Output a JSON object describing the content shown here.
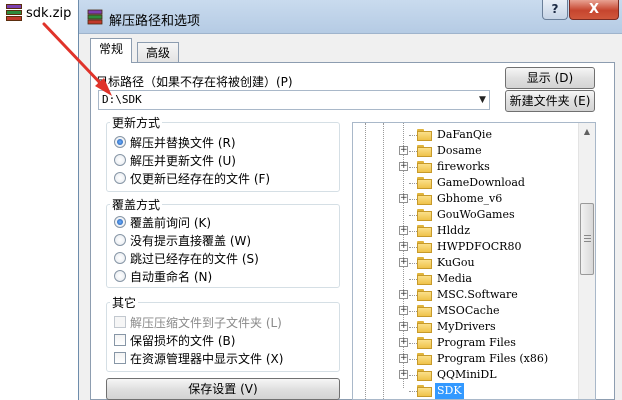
{
  "desktop": {
    "file_name": "sdk.zip"
  },
  "dialog": {
    "title": "解压路径和选项",
    "help_label": "?",
    "close_label": "X",
    "tabs": [
      {
        "label": "常规"
      },
      {
        "label": "高级"
      }
    ],
    "path_label": "目标路径（如果不存在将被创建）(P)",
    "path_value": "D:\\SDK",
    "show_button": "显示 (D)",
    "new_folder_button": "新建文件夹 (E)",
    "update_group": {
      "title": "更新方式",
      "options": [
        {
          "label": "解压并替换文件 (R)",
          "selected": true
        },
        {
          "label": "解压并更新文件 (U)",
          "selected": false
        },
        {
          "label": "仅更新已经存在的文件 (F)",
          "selected": false
        }
      ]
    },
    "overwrite_group": {
      "title": "覆盖方式",
      "options": [
        {
          "label": "覆盖前询问 (K)",
          "selected": true
        },
        {
          "label": "没有提示直接覆盖 (W)",
          "selected": false
        },
        {
          "label": "跳过已经存在的文件 (S)",
          "selected": false
        },
        {
          "label": "自动重命名 (N)",
          "selected": false
        }
      ]
    },
    "other_group": {
      "title": "其它",
      "options": [
        {
          "label": "解压压缩文件到子文件夹 (L)",
          "checked": false,
          "enabled": false
        },
        {
          "label": "保留损坏的文件 (B)",
          "checked": false,
          "enabled": true
        },
        {
          "label": "在资源管理器中显示文件 (X)",
          "checked": false,
          "enabled": true
        }
      ]
    },
    "save_button": "保存设置 (V)",
    "folder_tree": [
      {
        "name": "DaFanQie",
        "expandable": false
      },
      {
        "name": "Dosame",
        "expandable": true
      },
      {
        "name": "fireworks",
        "expandable": true
      },
      {
        "name": "GameDownload",
        "expandable": false
      },
      {
        "name": "Gbhome_v6",
        "expandable": true
      },
      {
        "name": "GouWoGames",
        "expandable": false
      },
      {
        "name": "Hlddz",
        "expandable": true
      },
      {
        "name": "HWPDFOCR80",
        "expandable": true
      },
      {
        "name": "KuGou",
        "expandable": true
      },
      {
        "name": "Media",
        "expandable": false
      },
      {
        "name": "MSC.Software",
        "expandable": true
      },
      {
        "name": "MSOCache",
        "expandable": true
      },
      {
        "name": "MyDrivers",
        "expandable": true
      },
      {
        "name": "Program Files",
        "expandable": true
      },
      {
        "name": "Program Files (x86)",
        "expandable": true
      },
      {
        "name": "QQMiniDL",
        "expandable": true
      },
      {
        "name": "SDK",
        "expandable": false,
        "selected": true
      }
    ],
    "colors": {
      "selection": "#3399ff",
      "titlebar": "#c9dbee",
      "close": "#c6452e",
      "arrow": "#e0332a"
    }
  }
}
